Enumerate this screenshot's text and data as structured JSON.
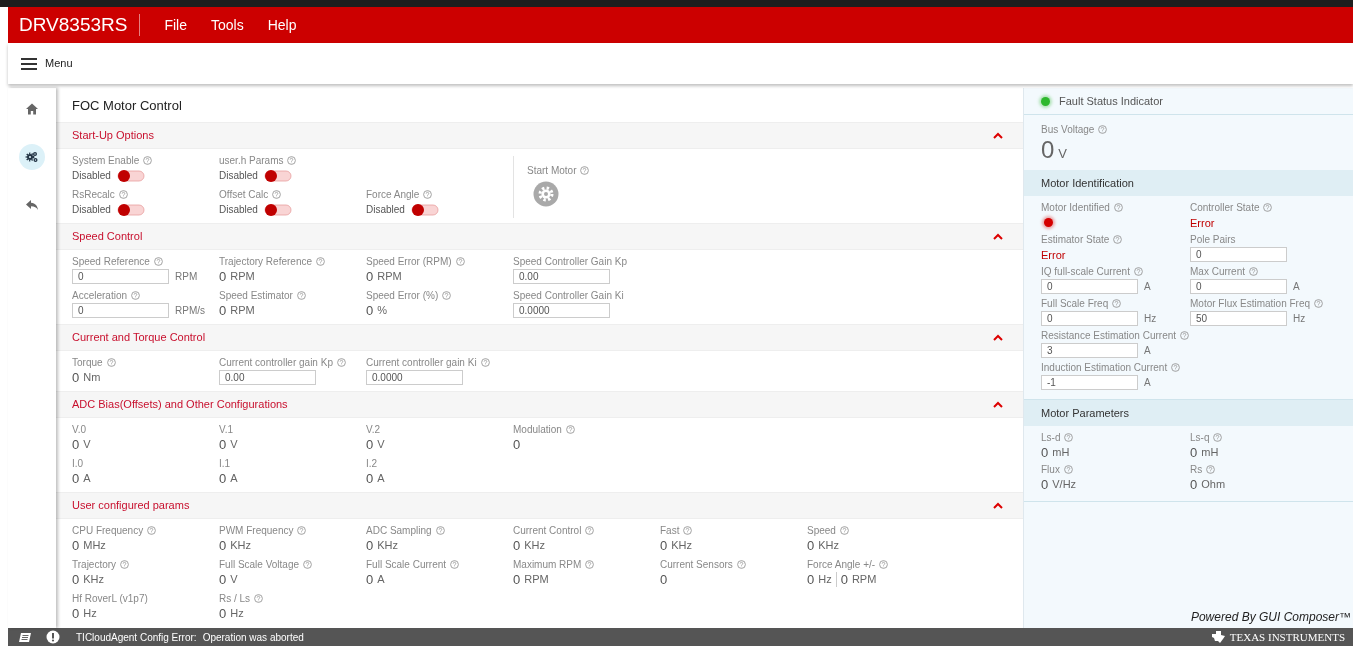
{
  "app": {
    "title": "DRV8353RS",
    "menus": [
      "File",
      "Tools",
      "Help"
    ]
  },
  "menu_button": {
    "label": "Menu"
  },
  "rail": [
    {
      "selected": false
    },
    {
      "selected": true
    },
    {
      "selected": false
    }
  ],
  "page_title": "FOC Motor Control",
  "sections": [
    {
      "title": "Start-Up Options",
      "expanded": true,
      "rows": [
        [
          {
            "kind": "toggle",
            "label": "System Enable",
            "help": true,
            "state_text": "Disabled",
            "on": false
          },
          {
            "kind": "toggle",
            "label": "user.h Params",
            "help": true,
            "state_text": "Disabled",
            "on": false
          }
        ],
        [
          {
            "kind": "toggle",
            "label": "RsRecalc",
            "help": true,
            "state_text": "Disabled",
            "on": false
          },
          {
            "kind": "toggle",
            "label": "Offset Calc",
            "help": true,
            "state_text": "Disabled",
            "on": false
          },
          {
            "kind": "toggle",
            "label": "Force Angle",
            "help": true,
            "state_text": "Disabled",
            "on": false
          }
        ]
      ],
      "action": {
        "label": "Start Motor",
        "help": true
      }
    },
    {
      "title": "Speed Control",
      "expanded": true,
      "rows": [
        [
          {
            "kind": "field",
            "label": "Speed Reference",
            "help": true,
            "value": "0",
            "unit": "RPM"
          },
          {
            "kind": "readout",
            "label": "Trajectory Reference",
            "help": true,
            "value": "0",
            "unit": "RPM"
          },
          {
            "kind": "readout",
            "label": "Speed Error (RPM)",
            "help": true,
            "value": "0",
            "unit": "RPM"
          },
          {
            "kind": "field",
            "label": "Speed Controller Gain Kp",
            "help": false,
            "value": "0.00"
          }
        ],
        [
          {
            "kind": "field",
            "label": "Acceleration",
            "help": true,
            "value": "0",
            "unit": "RPM/s"
          },
          {
            "kind": "readout",
            "label": "Speed Estimator",
            "help": true,
            "value": "0",
            "unit": "RPM"
          },
          {
            "kind": "readout",
            "label": "Speed Error (%)",
            "help": true,
            "value": "0",
            "unit": "%"
          },
          {
            "kind": "field",
            "label": "Speed Controller Gain Ki",
            "help": false,
            "value": "0.0000"
          }
        ]
      ]
    },
    {
      "title": "Current and Torque Control",
      "expanded": true,
      "rows": [
        [
          {
            "kind": "readout",
            "label": "Torque",
            "help": true,
            "value": "0",
            "unit": "Nm"
          },
          {
            "kind": "field",
            "label": "Current controller gain Kp",
            "help": true,
            "value": "0.00"
          },
          {
            "kind": "field",
            "label": "Current controller gain Ki",
            "help": true,
            "value": "0.0000"
          }
        ]
      ]
    },
    {
      "title": "ADC Bias(Offsets) and Other Configurations",
      "expanded": true,
      "rows": [
        [
          {
            "kind": "readout",
            "label": "V.0",
            "help": false,
            "value": "0",
            "unit": "V"
          },
          {
            "kind": "readout",
            "label": "V.1",
            "help": false,
            "value": "0",
            "unit": "V"
          },
          {
            "kind": "readout",
            "label": "V.2",
            "help": false,
            "value": "0",
            "unit": "V"
          },
          {
            "kind": "readout",
            "label": "Modulation",
            "help": true,
            "value": "0"
          }
        ],
        [
          {
            "kind": "readout",
            "label": "I.0",
            "help": false,
            "value": "0",
            "unit": "A"
          },
          {
            "kind": "readout",
            "label": "I.1",
            "help": false,
            "value": "0",
            "unit": "A"
          },
          {
            "kind": "readout",
            "label": "I.2",
            "help": false,
            "value": "0",
            "unit": "A"
          }
        ]
      ]
    },
    {
      "title": "User configured params",
      "expanded": true,
      "rows": [
        [
          {
            "kind": "readout",
            "label": "CPU Frequency",
            "help": true,
            "value": "0",
            "unit": "MHz"
          },
          {
            "kind": "readout",
            "label": "PWM Frequency",
            "help": true,
            "value": "0",
            "unit": "KHz"
          },
          {
            "kind": "readout",
            "label": "ADC Sampling",
            "help": true,
            "value": "0",
            "unit": "KHz"
          },
          {
            "kind": "readout",
            "label": "Current Control",
            "help": true,
            "value": "0",
            "unit": "KHz"
          },
          {
            "kind": "readout",
            "label": "Fast",
            "help": true,
            "value": "0",
            "unit": "KHz"
          },
          {
            "kind": "readout",
            "label": "Speed",
            "help": true,
            "value": "0",
            "unit": "KHz"
          }
        ],
        [
          {
            "kind": "readout",
            "label": "Trajectory",
            "help": true,
            "value": "0",
            "unit": "KHz"
          },
          {
            "kind": "readout",
            "label": "Full Scale Voltage",
            "help": true,
            "value": "0",
            "unit": "V"
          },
          {
            "kind": "readout",
            "label": "Full Scale Current",
            "help": true,
            "value": "0",
            "unit": "A"
          },
          {
            "kind": "readout",
            "label": "Maximum RPM",
            "help": true,
            "value": "0",
            "unit": "RPM"
          },
          {
            "kind": "readout",
            "label": "Current Sensors",
            "help": true,
            "value": "0"
          },
          {
            "kind": "dual",
            "label": "Force Angle +/-",
            "help": true,
            "values": [
              {
                "value": "0",
                "unit": "Hz"
              },
              {
                "value": "0",
                "unit": "RPM"
              }
            ]
          }
        ],
        [
          {
            "kind": "readout",
            "label": "Hf RoverL (v1p7)",
            "help": false,
            "value": "0",
            "unit": "Hz"
          },
          {
            "kind": "readout",
            "label": "Rs / Ls",
            "help": true,
            "value": "0",
            "unit": "Hz"
          }
        ]
      ]
    }
  ],
  "fault": {
    "label": "Fault Status Indicator",
    "color": "#2db82d"
  },
  "bus_voltage": {
    "label": "Bus Voltage",
    "help": true,
    "value": "0",
    "unit": "V"
  },
  "side_sections": [
    {
      "title": "Motor Identification",
      "rows": [
        [
          {
            "kind": "led",
            "label": "Motor Identified",
            "help": true,
            "color": "#d40000"
          },
          {
            "kind": "status",
            "label": "Controller State",
            "help": true,
            "value": "Error"
          }
        ],
        [
          {
            "kind": "status",
            "label": "Estimator State",
            "help": true,
            "value": "Error"
          },
          {
            "kind": "field",
            "label": "Pole Pairs",
            "help": false,
            "value": "0"
          }
        ],
        [
          {
            "kind": "field",
            "label": "IQ full-scale Current",
            "help": true,
            "value": "0",
            "unit": "A"
          },
          {
            "kind": "field",
            "label": "Max Current",
            "help": true,
            "value": "0",
            "unit": "A"
          }
        ],
        [
          {
            "kind": "field",
            "label": "Full Scale Freq",
            "help": true,
            "value": "0",
            "unit": "Hz"
          },
          {
            "kind": "field",
            "label": "Motor Flux Estimation Freq",
            "help": true,
            "value": "50",
            "unit": "Hz"
          }
        ],
        [
          {
            "kind": "field",
            "label": "Resistance Estimation Current",
            "help": true,
            "value": "3",
            "unit": "A"
          }
        ],
        [
          {
            "kind": "field",
            "label": "Induction Estimation Current",
            "help": true,
            "value": "-1",
            "unit": "A"
          }
        ]
      ]
    },
    {
      "title": "Motor Parameters",
      "rows": [
        [
          {
            "kind": "readout",
            "label": "Ls-d",
            "help": true,
            "value": "0",
            "unit": "mH"
          },
          {
            "kind": "readout",
            "label": "Ls-q",
            "help": true,
            "value": "0",
            "unit": "mH"
          }
        ],
        [
          {
            "kind": "readout",
            "label": "Flux",
            "help": true,
            "value": "0",
            "unit": "V/Hz"
          },
          {
            "kind": "readout",
            "label": "Rs",
            "help": true,
            "value": "0",
            "unit": "Ohm"
          }
        ]
      ]
    }
  ],
  "powered_by": "Powered By GUI Composer™",
  "status_bar": {
    "error_label": "TICloudAgent Config Error:",
    "message": "Operation was aborted",
    "vendor": "TEXAS INSTRUMENTS"
  }
}
